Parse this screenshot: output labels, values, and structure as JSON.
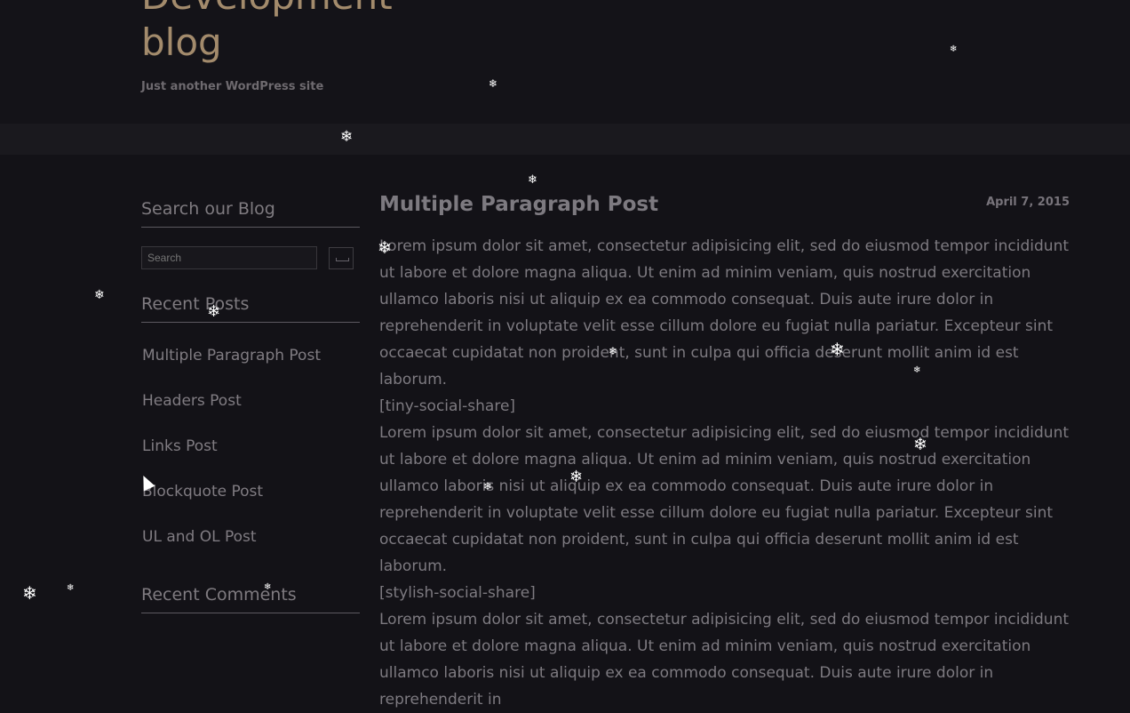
{
  "header": {
    "site_title": "Development blog",
    "tagline": "Just another WordPress site"
  },
  "sidebar": {
    "search_title": "Search our Blog",
    "search_placeholder": "Search",
    "recent_posts_title": "Recent Posts",
    "recent_posts": [
      "Multiple Paragraph Post",
      "Headers Post",
      "Links Post",
      "Blockquote Post",
      "UL and OL Post"
    ],
    "recent_comments_title": "Recent Comments"
  },
  "post": {
    "title": "Multiple Paragraph Post",
    "date": "April 7, 2015",
    "paragraphs": [
      "Lorem ipsum dolor sit amet, consectetur adipisicing elit, sed do eiusmod tempor incididunt ut labore et dolore magna aliqua. Ut enim ad minim veniam, quis nostrud exercitation ullamco laboris nisi ut aliquip ex ea commodo consequat. Duis aute irure dolor in reprehenderit in voluptate velit esse cillum dolore eu fugiat nulla pariatur. Excepteur sint occaecat cupidatat non proident, sunt in culpa qui officia deserunt mollit anim id est laborum.",
      "[tiny-social-share]",
      "Lorem ipsum dolor sit amet, consectetur adipisicing elit, sed do eiusmod tempor incididunt ut labore et dolore magna aliqua. Ut enim ad minim veniam, quis nostrud exercitation ullamco laboris nisi ut aliquip ex ea commodo consequat. Duis aute irure dolor in reprehenderit in voluptate velit esse cillum dolore eu fugiat nulla pariatur. Excepteur sint occaecat cupidatat non proident, sunt in culpa qui officia deserunt mollit anim id est laborum.",
      "[stylish-social-share]",
      "Lorem ipsum dolor sit amet, consectetur adipisicing elit, sed do eiusmod tempor incididunt ut labore et dolore magna aliqua. Ut enim ad minim veniam, quis nostrud exercitation ullamco laboris nisi ut aliquip ex ea commodo consequat. Duis aute irure dolor in reprehenderit in"
    ]
  },
  "decorations": {
    "snowflake_glyph": "❄",
    "snowflake_icon": "snowflake-icon"
  },
  "colors": {
    "background": "#131217",
    "title_gold": "#a38b6c",
    "text": "#7d7a80"
  }
}
